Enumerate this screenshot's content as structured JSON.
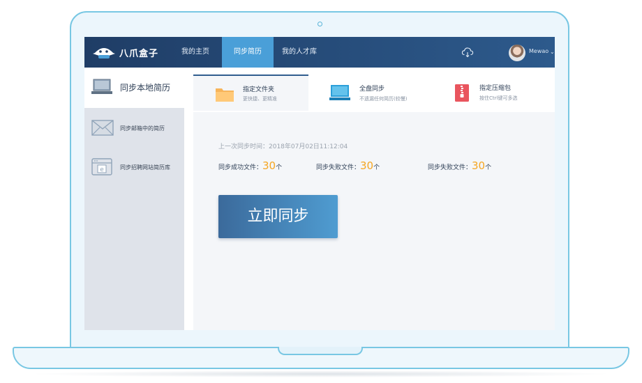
{
  "app": {
    "logo_text": "八爪盒子"
  },
  "nav": {
    "items": [
      {
        "label": "我的主页"
      },
      {
        "label": "同步简历",
        "active": true
      },
      {
        "label": "我的人才库"
      }
    ],
    "user_name": "Mewao",
    "icons": [
      "cloud-sync-icon",
      "chevron-down-icon"
    ]
  },
  "sidebar": {
    "items": [
      {
        "label": "同步本地简历",
        "icon": "laptop-icon",
        "active": true
      },
      {
        "label": "同步邮箱中的简历",
        "icon": "envelope-icon"
      },
      {
        "label": "同步招聘网站简历库",
        "icon": "browser-icon"
      }
    ]
  },
  "tabs": [
    {
      "title": "指定文件夹",
      "subtitle": "更快捷、更精准",
      "icon": "folder-icon",
      "active": true
    },
    {
      "title": "全盘同步",
      "subtitle": "不遗漏任何简历(较慢)",
      "icon": "monitor-icon"
    },
    {
      "title": "指定压缩包",
      "subtitle": "按住Ctrl键可多选",
      "icon": "zip-file-icon"
    }
  ],
  "sync": {
    "last_sync": "上一次同步时间：2018年07月02日11:12:04",
    "stats": [
      {
        "label": "同步成功文件：",
        "value": "30",
        "unit": "个"
      },
      {
        "label": "同步失败文件：",
        "value": "30",
        "unit": "个"
      },
      {
        "label": "同步失败文件：",
        "value": "30",
        "unit": "个"
      }
    ],
    "button_label": "立即同步"
  },
  "colors": {
    "nav_bg": "#1f3d66",
    "nav_active": "#4a9fd8",
    "accent_number": "#f5a623",
    "frame": "#78c7e3"
  }
}
